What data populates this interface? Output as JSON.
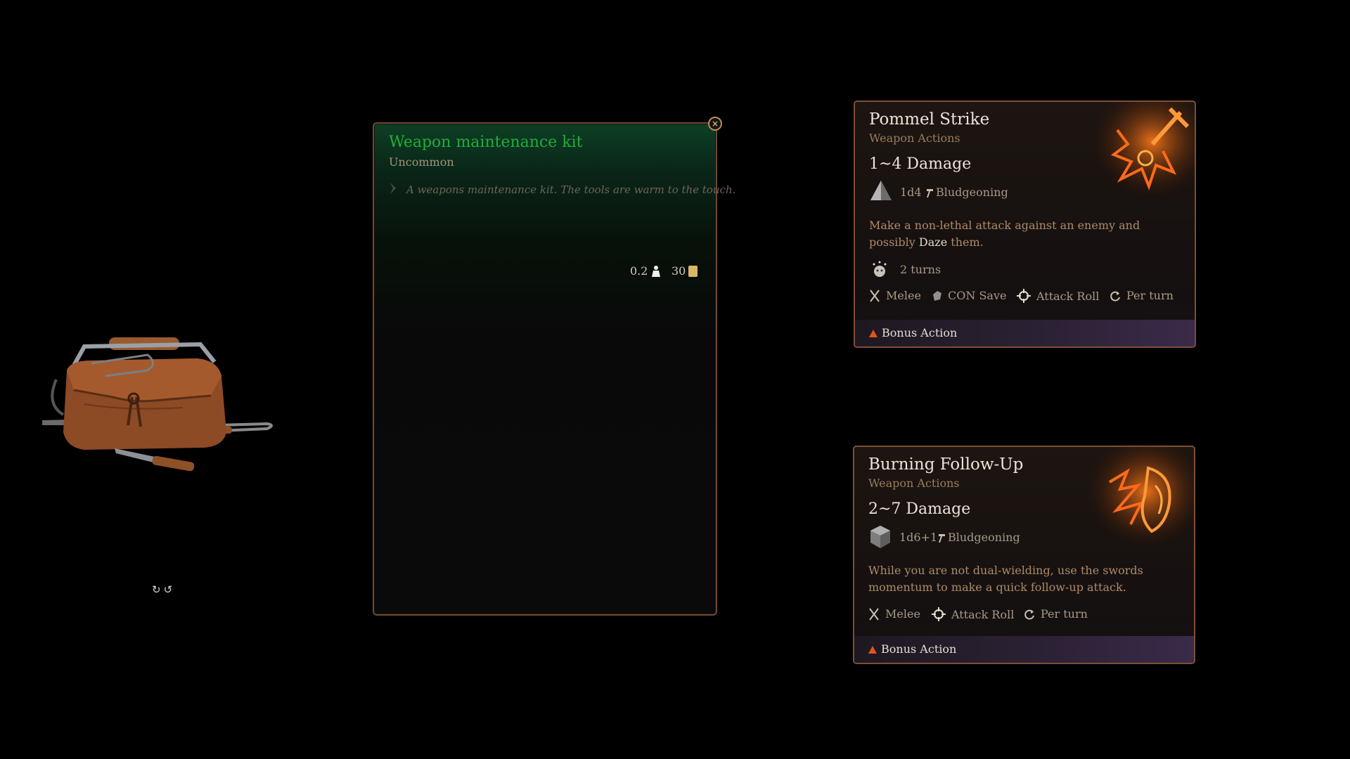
{
  "item": {
    "name": "Weapon maintenance kit",
    "rarity": "Uncommon",
    "description": "A weapons maintenance kit. The tools are warm to the touch.",
    "weight": "0.2",
    "value": "30",
    "close_label": "×"
  },
  "preview": {
    "rotate_left": "↻",
    "rotate_right": "↺"
  },
  "actions": [
    {
      "title": "Pommel Strike",
      "category": "Weapon Actions",
      "damage": "1~4 Damage",
      "dice": "1d4",
      "damage_type": "Bludgeoning",
      "description_pre": "Make a non-lethal attack against an enemy and possibly",
      "description_highlight": "Daze",
      "description_post": "them.",
      "duration": "2 turns",
      "tags": [
        "Melee",
        "CON Save",
        "Attack Roll",
        "Per turn"
      ],
      "cost": "Bonus Action"
    },
    {
      "title": "Burning Follow-Up",
      "category": "Weapon Actions",
      "damage": "2~7 Damage",
      "dice": "1d6+1",
      "damage_type": "Bludgeoning",
      "description": "While you are not dual-wielding, use the swords momentum to make a quick follow-up attack.",
      "tags": [
        "Melee",
        "Attack Roll",
        "Per turn"
      ],
      "cost": "Bonus Action"
    }
  ],
  "colors": {
    "rarity_green": "#1fae3a",
    "accent_orange": "#e0541d",
    "card_border": "#7d4f37"
  },
  "icons": [
    "kit-image",
    "rotate-icon",
    "close-icon",
    "weight-icon",
    "coin-icon",
    "tetrahedron-dice-icon",
    "cube-dice-icon",
    "hammer-icon",
    "daze-icon",
    "melee-icon",
    "con-save-icon",
    "attack-roll-icon",
    "per-turn-icon",
    "bonus-action-icon"
  ]
}
